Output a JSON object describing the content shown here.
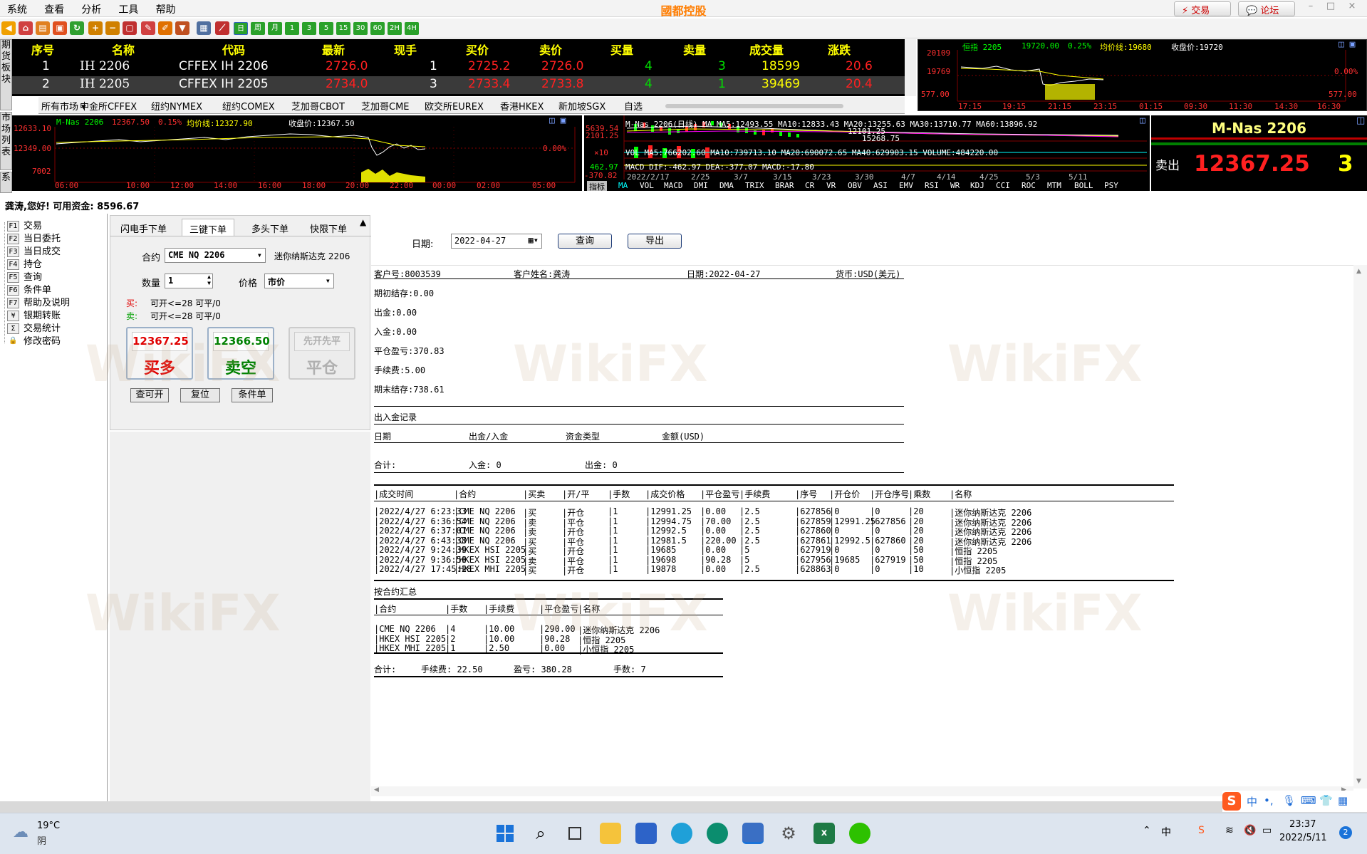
{
  "menu": [
    "系统",
    "查看",
    "分析",
    "工具",
    "帮助"
  ],
  "app_title": "國都控股",
  "top_buttons": {
    "trade": "交易",
    "forum": "论坛"
  },
  "window_controls": [
    "–",
    "□",
    "×"
  ],
  "toolbar_periods": [
    "日",
    "周",
    "月",
    "1",
    "3",
    "5",
    "15",
    "30",
    "60",
    "2H",
    "4H"
  ],
  "side_tabs": {
    "futures": "期货板块",
    "market": "市场列表",
    "system": "系"
  },
  "quote_table": {
    "headers": [
      "序号",
      "名称",
      "代码",
      "最新",
      "现手",
      "买价",
      "卖价",
      "买量",
      "卖量",
      "成交量",
      "涨跌"
    ],
    "rows": [
      {
        "idx": "1",
        "name": "IH 2206",
        "code": "CFFEX IH 2206",
        "last": "2726.0",
        "hand": "1",
        "bid": "2725.2",
        "ask": "2726.0",
        "bidvol": "4",
        "askvol": "3",
        "volume": "18599",
        "change": "20.6"
      },
      {
        "idx": "2",
        "name": "IH 2205",
        "code": "CFFEX IH 2205",
        "last": "2734.0",
        "hand": "3",
        "bid": "2733.4",
        "ask": "2733.8",
        "bidvol": "4",
        "askvol": "1",
        "volume": "39469",
        "change": "20.4"
      }
    ]
  },
  "market_tabs": [
    "所有市场",
    "中金所CFFEX",
    "纽约NYMEX",
    "纽约COMEX",
    "芝加哥CBOT",
    "芝加哥CME",
    "欧交所EUREX",
    "香港HKEX",
    "新加坡SGX",
    "自选"
  ],
  "hsi_chart": {
    "title": "恒指 2205",
    "price": "19720.00",
    "pct": "0.25%",
    "avg": "均价线:19680",
    "close": "收盘价:19720",
    "yticks": [
      "20109",
      "19769",
      "577.00"
    ],
    "right_ticks": [
      "0.00%",
      "577.00"
    ],
    "xticks": [
      "17:15",
      "19:15",
      "21:15",
      "23:15",
      "01:15",
      "09:30",
      "11:30",
      "14:30",
      "16:30"
    ]
  },
  "mnas_chart": {
    "title": "M-Nas 2206",
    "price": "12367.50",
    "pct": "0.15%",
    "avg": "均价线:12327.90",
    "close": "收盘价:12367.50",
    "yticks": [
      "12633.10",
      "12349.00",
      "7002"
    ],
    "right_ticks": [
      "0.00%"
    ],
    "xticks": [
      "06:00",
      "10:00",
      "12:00",
      "14:00",
      "16:00",
      "18:00",
      "20:00",
      "22:00",
      "00:00",
      "02:00",
      "05:00"
    ]
  },
  "daily_chart": {
    "ma_line": "M-Nas 2206(日线) MA MA5:12493.55 MA10:12833.43 MA20:13255.63 MA30:13710.77 MA60:13896.92",
    "hi_label": "15268.75",
    "mid_label": "12101.25",
    "yticks": [
      "5639.54",
      "2101.25",
      "×10",
      "462.97",
      "-370.82"
    ],
    "vol_line": "VOL MA5:766202.60 MA10:739713.10 MA20:690072.65 MA40:629903.15 VOLUME:484220.00",
    "macd_line": "MACD DIF:-462.97 DEA:-377.07 MACD:-17.80",
    "dates": [
      "2022/2/17",
      "2/25",
      "3/7",
      "3/15",
      "3/23",
      "3/30",
      "4/7",
      "4/14",
      "4/25",
      "5/3",
      "5/11"
    ],
    "indicators": [
      "指标",
      "MA",
      "VOL",
      "MACD",
      "DMI",
      "DMA",
      "TRIX",
      "BRAR",
      "CR",
      "VR",
      "OBV",
      "ASI",
      "EMV",
      "RSI",
      "WR",
      "KDJ",
      "CCI",
      "ROC",
      "MTM",
      "BOLL",
      "PSY"
    ]
  },
  "ticker_box": {
    "symbol": "M-Nas 2206",
    "side": "卖出",
    "price": "12367.25",
    "qty": "3"
  },
  "greeting": "龚涛,您好! 可用资金: 8596.67",
  "nav": [
    {
      "key": "F1",
      "label": "交易"
    },
    {
      "key": "F2",
      "label": "当日委托"
    },
    {
      "key": "F3",
      "label": "当日成交"
    },
    {
      "key": "F4",
      "label": "持仓"
    },
    {
      "key": "F5",
      "label": "查询"
    },
    {
      "key": "F6",
      "label": "条件单"
    },
    {
      "key": "F7",
      "label": "帮助及说明"
    },
    {
      "key": "¥",
      "label": "银期转账"
    },
    {
      "key": "Σ",
      "label": "交易统计"
    },
    {
      "key": "🔒",
      "label": "修改密码"
    }
  ],
  "order_panel": {
    "tabs": [
      "闪电手下单",
      "三键下单",
      "多头下单",
      "快限下单"
    ],
    "contract_label": "合约",
    "contract_value": "CME NQ 2206",
    "contract_name": "迷你纳斯达克 2206",
    "qty_label": "数量",
    "qty_value": "1",
    "price_label": "价格",
    "price_value": "市价",
    "buy_info": {
      "tag": "买:",
      "text": "可开<=28  可平/0"
    },
    "sell_info": {
      "tag": "卖:",
      "text": "可开<=28  可平/0"
    },
    "buy_btn": {
      "price": "12367.25",
      "label": "买多"
    },
    "sell_btn": {
      "price": "12366.50",
      "label": "卖空"
    },
    "close_btn": {
      "price": "先开先平",
      "label": "平仓"
    },
    "small_buttons": [
      "查可开",
      "复位",
      "条件单"
    ]
  },
  "query_bar": {
    "date_label": "日期:",
    "date_value": "2022-04-27",
    "query": "查询",
    "export": "导出"
  },
  "report": {
    "customer_no": "客户号:8003539",
    "customer_name": "客户姓名:龚涛",
    "date": "日期:2022-04-27",
    "currency": "货币:USD(美元)",
    "summary": [
      "期初结存:0.00",
      "出金:0.00",
      "入金:0.00",
      "平仓盈亏:370.83",
      "手续费:5.00",
      "期末结存:738.61"
    ],
    "cash_title": "出入金记录",
    "cash_headers": [
      "日期",
      "出金/入金",
      "资金类型",
      "金额(USD)"
    ],
    "cash_total": {
      "label": "合计:",
      "in": "入金: 0",
      "out": "出金: 0"
    },
    "trade_headers": [
      "成交时间",
      "合约",
      "买卖",
      "开/平",
      "手数",
      "成交价格",
      "平仓盈亏",
      "手续费",
      "序号",
      "开仓价",
      "开仓序号",
      "乘数",
      "名称"
    ],
    "trades": [
      [
        "2022/4/27 6:23:33",
        "CME NQ 2206",
        "买",
        "开仓",
        "1",
        "12991.25",
        "0.00",
        "2.5",
        "627856",
        "0",
        "0",
        "20",
        "迷你纳斯达克 2206"
      ],
      [
        "2022/4/27 6:36:54",
        "CME NQ 2206",
        "卖",
        "平仓",
        "1",
        "12994.75",
        "70.00",
        "2.5",
        "627859",
        "12991.25",
        "627856",
        "20",
        "迷你纳斯达克 2206"
      ],
      [
        "2022/4/27 6:37:01",
        "CME NQ 2206",
        "卖",
        "开仓",
        "1",
        "12992.5",
        "0.00",
        "2.5",
        "627860",
        "0",
        "0",
        "20",
        "迷你纳斯达克 2206"
      ],
      [
        "2022/4/27 6:43:38",
        "CME NQ 2206",
        "买",
        "平仓",
        "1",
        "12981.5",
        "220.00",
        "2.5",
        "627861",
        "12992.5",
        "627860",
        "20",
        "迷你纳斯达克 2206"
      ],
      [
        "2022/4/27 9:24:39",
        "HKEX HSI 2205",
        "买",
        "开仓",
        "1",
        "19685",
        "0.00",
        "5",
        "627919",
        "0",
        "0",
        "50",
        "恒指 2205"
      ],
      [
        "2022/4/27 9:36:50",
        "HKEX HSI 2205",
        "卖",
        "平仓",
        "1",
        "19698",
        "90.28",
        "5",
        "627956",
        "19685",
        "627919",
        "50",
        "恒指 2205"
      ],
      [
        "2022/4/27 17:45:28",
        "HKEX MHI 2205",
        "买",
        "开仓",
        "1",
        "19878",
        "0.00",
        "2.5",
        "628863",
        "0",
        "0",
        "10",
        "小恒指 2205"
      ]
    ],
    "summary_title": "按合约汇总",
    "sum_headers": [
      "合约",
      "手数",
      "手续费",
      "平仓盈亏",
      "名称"
    ],
    "sum_rows": [
      [
        "CME NQ 2206",
        "4",
        "10.00",
        "290.00",
        "迷你纳斯达克 2206"
      ],
      [
        "HKEX HSI 2205",
        "2",
        "10.00",
        "90.28",
        "恒指 2205"
      ],
      [
        "HKEX MHI 2205",
        "1",
        "2.50",
        "0.00",
        "小恒指 2205"
      ]
    ],
    "sum_total": {
      "label": "合计:",
      "fee": "手续费: 22.50",
      "pnl": "盈亏: 380.28",
      "hands": "手数: 7"
    }
  },
  "watermark": "WikiFX",
  "taskbar": {
    "temp": "19°C",
    "weather": "阴",
    "time": "23:37",
    "date": "2022/5/11",
    "badge": "2",
    "ime": "中"
  },
  "colors": {
    "up": "#ff2020",
    "down": "#00c000",
    "quote_yellow": "#ffff00",
    "accent_orange": "#ff7d00"
  }
}
